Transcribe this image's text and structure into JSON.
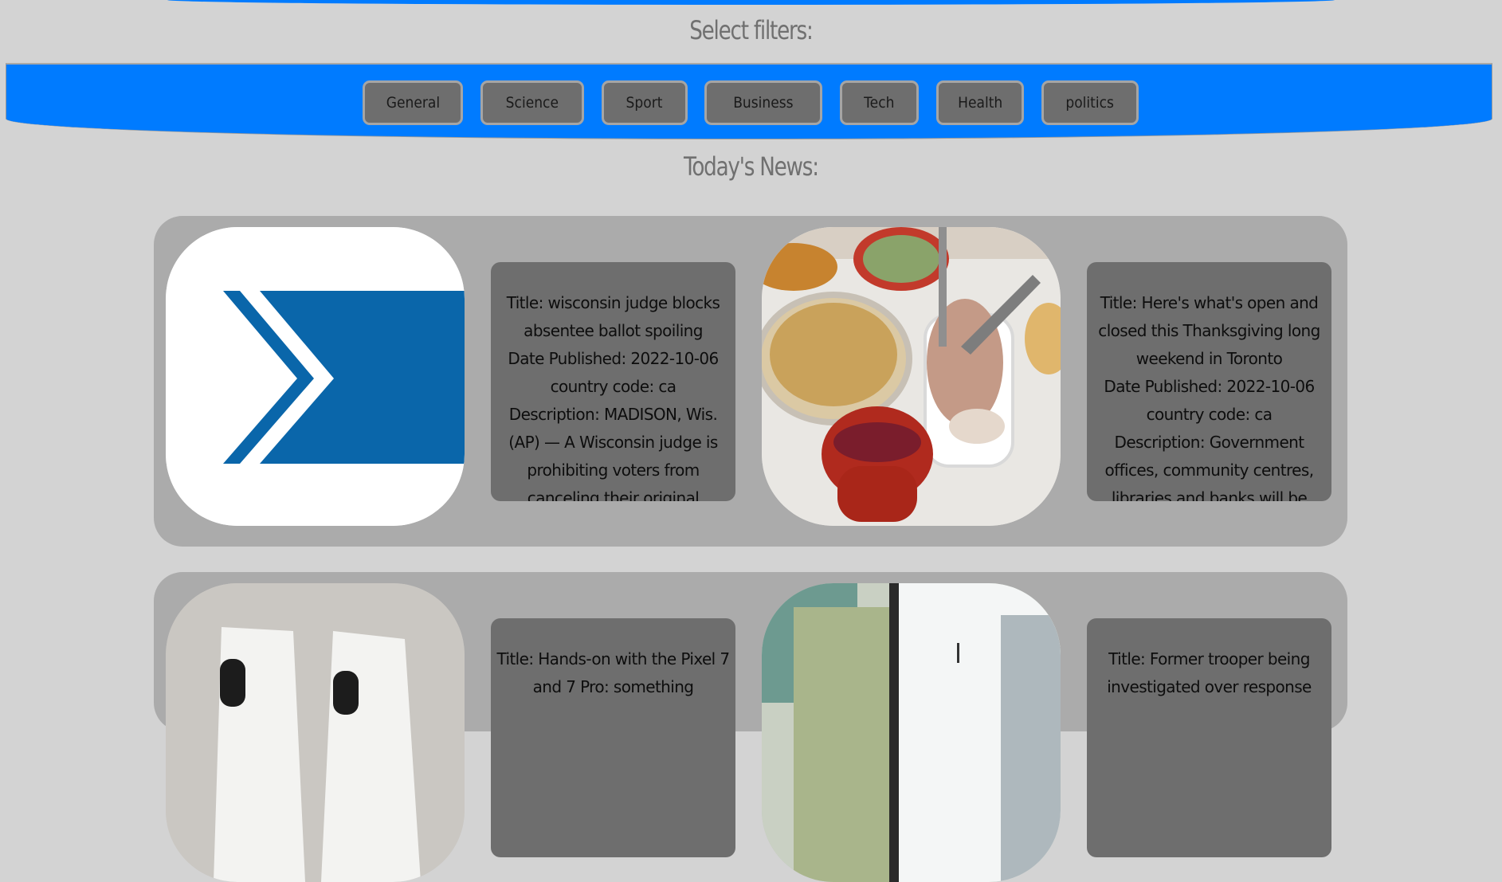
{
  "filters": {
    "heading": "Select filters:",
    "buttons": [
      "General",
      "Science",
      "Sport",
      "Business",
      "Tech",
      "Health",
      "politics"
    ]
  },
  "news": {
    "heading": "Today's News:",
    "articles": [
      {
        "title": "Title: wisconsin judge blocks absentee ballot spoiling",
        "date": "Date Published: 2022-10-06",
        "country": "country code: ca",
        "description": "Description: MADISON, Wis. (AP) — A Wisconsin judge is prohibiting voters from canceling their original"
      },
      {
        "title": "Title: Here's what's open and closed this Thanksgiving long weekend in Toronto",
        "date": "Date Published: 2022-10-06",
        "country": "country code: ca",
        "description": "Description: Government offices, community centres, libraries and banks will be"
      },
      {
        "title": "Title: Hands-on with the Pixel 7 and 7 Pro: something",
        "date": "",
        "country": "",
        "description": ""
      },
      {
        "title": "Title: Former trooper being investigated over response",
        "date": "",
        "country": "",
        "description": ""
      }
    ]
  },
  "colors": {
    "page_bg": "#d3d3d3",
    "accent": "#007bff",
    "card_bg": "#ababab",
    "text_card_bg": "#6e6e6e",
    "button_bg": "#6e6e6e"
  },
  "icons": [
    "chevron-logo-image",
    "thanksgiving-food-image",
    "pixel-phones-image",
    "building-interior-image"
  ]
}
